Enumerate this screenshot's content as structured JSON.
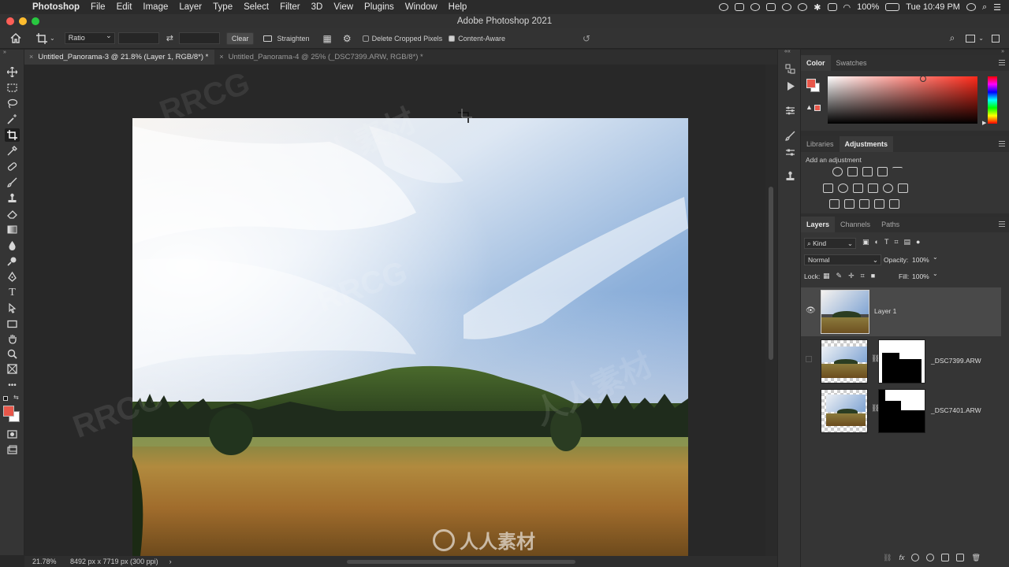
{
  "menubar": {
    "apple": "",
    "items": [
      "Photoshop",
      "File",
      "Edit",
      "Image",
      "Layer",
      "Type",
      "Select",
      "Filter",
      "3D",
      "View",
      "Plugins",
      "Window",
      "Help"
    ],
    "battery": "100%",
    "clock": "Tue 10:49 PM"
  },
  "window": {
    "title": "Adobe Photoshop 2021"
  },
  "options": {
    "ratio": "Ratio",
    "clear": "Clear",
    "straighten": "Straighten",
    "delete_cropped": "Delete Cropped Pixels",
    "content_aware": "Content-Aware"
  },
  "tabs": [
    {
      "label": "Untitled_Panorama-3 @ 21.8% (Layer 1, RGB/8*) *"
    },
    {
      "label": "Untitled_Panorama-4 @ 25% (_DSC7399.ARW, RGB/8*) *"
    }
  ],
  "status": {
    "zoom": "21.78%",
    "doc_info": "8492 px x 7719 px (300 ppi)"
  },
  "color_panel": {
    "tabs": [
      "Color",
      "Swatches"
    ],
    "foreground": "#e8574a",
    "background": "#ffffff"
  },
  "adjust_panel": {
    "tabs": [
      "Libraries",
      "Adjustments"
    ],
    "hint": "Add an adjustment"
  },
  "layers_panel": {
    "tabs": [
      "Layers",
      "Channels",
      "Paths"
    ],
    "filter": "Kind",
    "blend_mode": "Normal",
    "opacity_label": "Opacity:",
    "opacity": "100%",
    "lock_label": "Lock:",
    "fill_label": "Fill:",
    "fill": "100%",
    "layers": [
      {
        "name": "Layer 1",
        "visible": true,
        "selected": true
      },
      {
        "name": "_DSC7399.ARW",
        "visible": false,
        "selected": false
      },
      {
        "name": "_DSC7401.ARW",
        "visible": false,
        "selected": false
      }
    ]
  },
  "watermarks": [
    "RRCG",
    "人人素材"
  ],
  "footer_logo": "人人素材"
}
